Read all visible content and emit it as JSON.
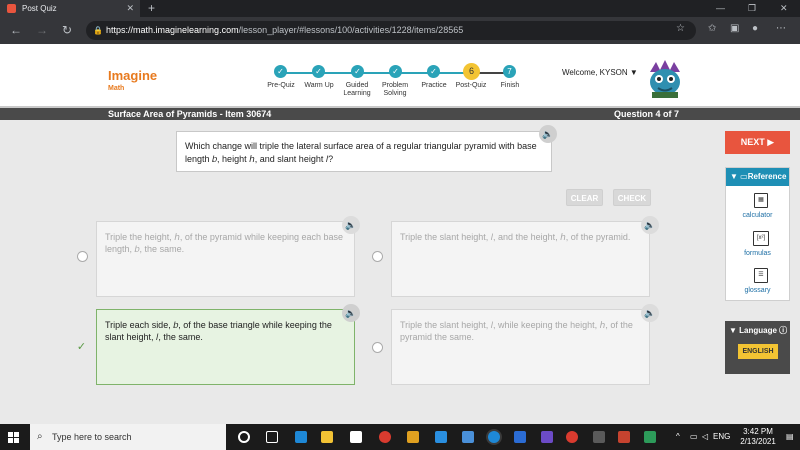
{
  "browser": {
    "tab_title": "Post Quiz",
    "tab_close": "✕",
    "new_tab": "+",
    "url_host": "https://math.imaginelearning.com",
    "url_path": "/lesson_player/#lessons/100/activities/1228/items/28565"
  },
  "header": {
    "brand": "Imagine",
    "brand_sub": "Math",
    "welcome": "Welcome, KYSON ▼"
  },
  "progress": {
    "steps": [
      {
        "label": "Pre-Quiz",
        "marker": "✓"
      },
      {
        "label": "Warm Up",
        "marker": "✓"
      },
      {
        "label": "Guided Learning",
        "marker": "✓"
      },
      {
        "label": "Problem Solving",
        "marker": "✓"
      },
      {
        "label": "Practice",
        "marker": "✓"
      },
      {
        "label": "Post-Quiz",
        "marker": "6"
      },
      {
        "label": "Finish",
        "marker": "7"
      }
    ]
  },
  "titlebar": {
    "lesson": "Surface Area of Pyramids - Item 30674",
    "question_num": "Question 4 of 7"
  },
  "question": {
    "text": "Which change will triple the lateral surface area of a regular triangular pyramid with base length 𝑏, height ℎ, and slant height 𝑙?"
  },
  "controls": {
    "clear": "CLEAR",
    "check": "CHECK",
    "next": "NEXT ▶"
  },
  "choices": [
    {
      "text": "Triple the height, ℎ, of the pyramid while keeping each base length, 𝑏, the same."
    },
    {
      "text": "Triple the slant height, 𝑙, and the height, ℎ, of the pyramid."
    },
    {
      "text": "Triple each side, 𝑏, of the base triangle while keeping the slant height, 𝑙, the same."
    },
    {
      "text": "Triple the slant height, 𝑙, while keeping the height, ℎ, of the pyramid the same."
    }
  ],
  "reference": {
    "title": "▼ ▭Reference",
    "items": [
      {
        "label": "calculator"
      },
      {
        "label": "formulas"
      },
      {
        "label": "glossary"
      }
    ]
  },
  "language": {
    "title": "▼ Language ⓘ",
    "button": "ENGLISH"
  },
  "taskbar": {
    "search_placeholder": "Type here to search",
    "lang": "ENG",
    "time": "3:42 PM",
    "date": "2/13/2021"
  }
}
